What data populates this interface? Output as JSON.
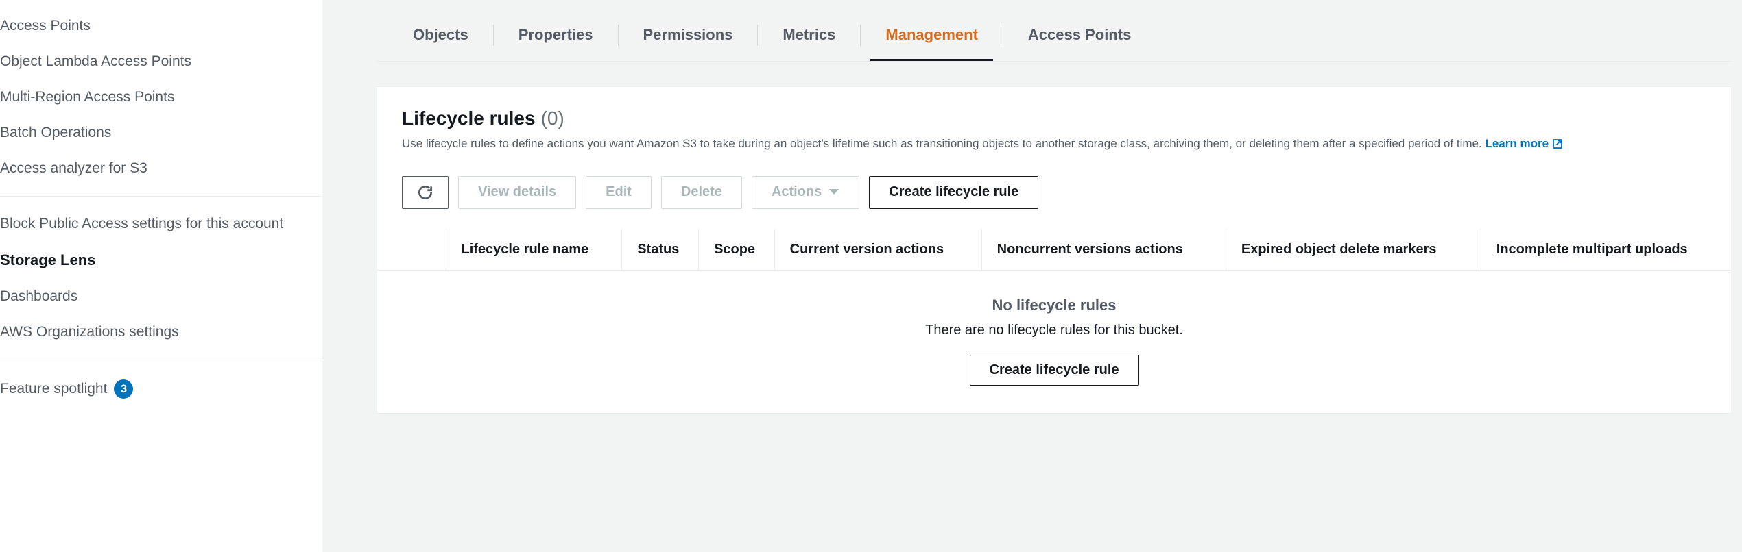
{
  "sidebar": {
    "items": [
      {
        "label": "Access Points"
      },
      {
        "label": "Object Lambda Access Points"
      },
      {
        "label": "Multi-Region Access Points"
      },
      {
        "label": "Batch Operations"
      },
      {
        "label": "Access analyzer for S3"
      }
    ],
    "block_public_label": "Block Public Access settings for this account",
    "storage_lens_heading": "Storage Lens",
    "storage_lens_items": [
      {
        "label": "Dashboards"
      },
      {
        "label": "AWS Organizations settings"
      }
    ],
    "feature_spotlight_label": "Feature spotlight",
    "feature_spotlight_count": "3"
  },
  "tabs": [
    {
      "label": "Objects",
      "active": false
    },
    {
      "label": "Properties",
      "active": false
    },
    {
      "label": "Permissions",
      "active": false
    },
    {
      "label": "Metrics",
      "active": false
    },
    {
      "label": "Management",
      "active": true
    },
    {
      "label": "Access Points",
      "active": false
    }
  ],
  "panel": {
    "title": "Lifecycle rules",
    "count": "(0)",
    "description": "Use lifecycle rules to define actions you want Amazon S3 to take during an object's lifetime such as transitioning objects to another storage class, archiving them, or deleting them after a specified period of time.",
    "learn_more": "Learn more",
    "buttons": {
      "view_details": "View details",
      "edit": "Edit",
      "delete": "Delete",
      "actions": "Actions",
      "create": "Create lifecycle rule"
    },
    "table": {
      "headers": [
        "Lifecycle rule name",
        "Status",
        "Scope",
        "Current version actions",
        "Noncurrent versions actions",
        "Expired object delete markers",
        "Incomplete multipart uploads"
      ]
    },
    "empty": {
      "title": "No lifecycle rules",
      "description": "There are no lifecycle rules for this bucket.",
      "button": "Create lifecycle rule"
    }
  }
}
